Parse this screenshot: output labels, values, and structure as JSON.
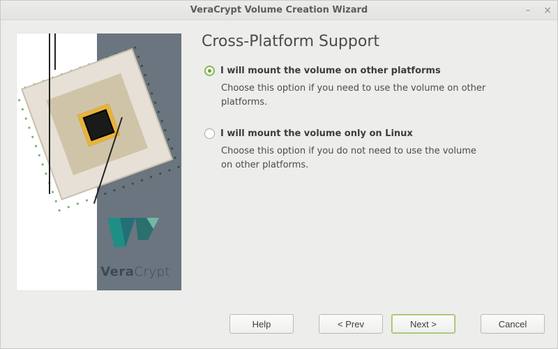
{
  "window": {
    "title": "VeraCrypt Volume Creation Wizard"
  },
  "page": {
    "heading": "Cross-Platform Support"
  },
  "options": [
    {
      "label": "I will mount the volume on other platforms",
      "desc": "Choose this option if you need to use the volume on other platforms.",
      "selected": true
    },
    {
      "label": "I will mount the volume only on Linux",
      "desc": "Choose this option if you do not need to use the volume on other platforms.",
      "selected": false
    }
  ],
  "buttons": {
    "help": "Help",
    "prev": "< Prev",
    "next": "Next >",
    "cancel": "Cancel"
  },
  "branding": {
    "name_strong": "Vera",
    "name_light": "Crypt"
  }
}
